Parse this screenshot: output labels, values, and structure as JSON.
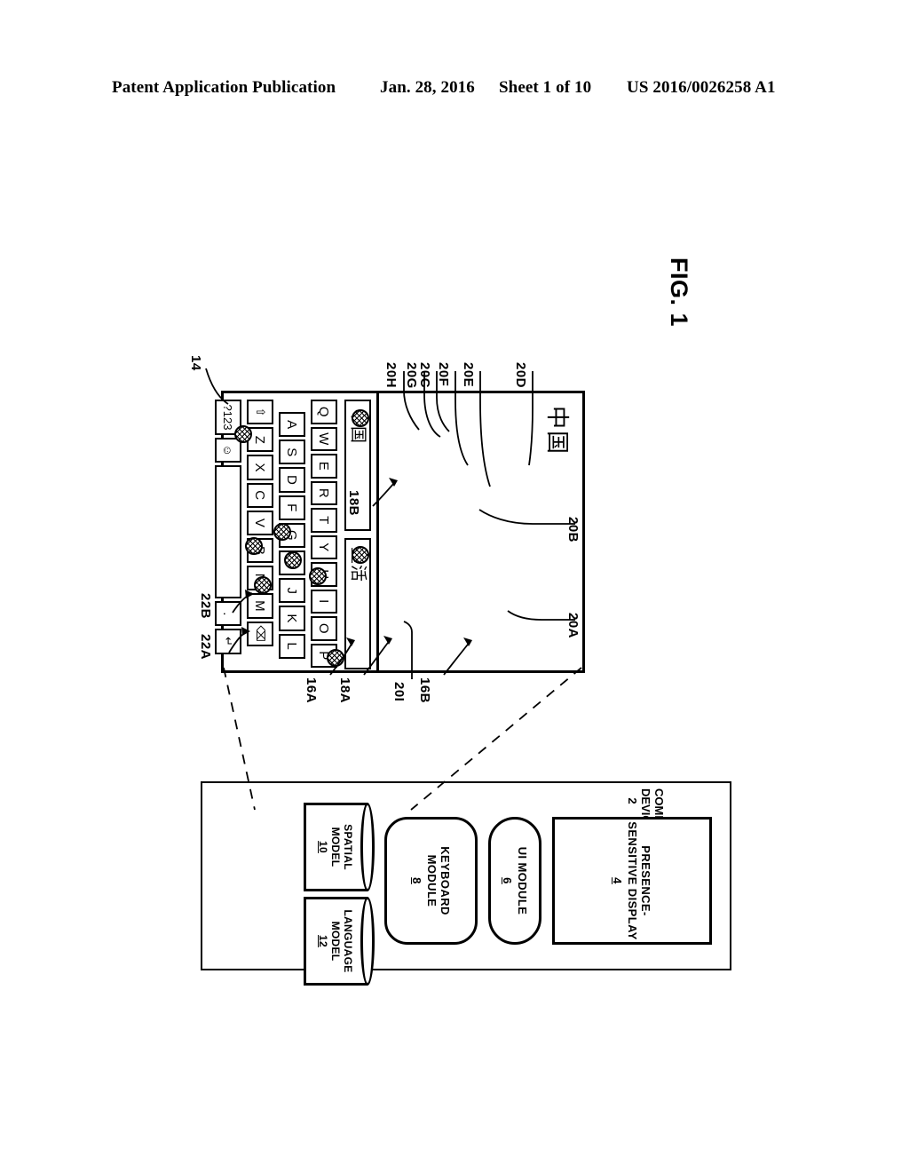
{
  "header": {
    "publication": "Patent Application Publication",
    "date": "Jan. 28, 2016",
    "sheet": "Sheet 1 of 10",
    "number": "US 2016/0026258 A1"
  },
  "figure": {
    "label": "FIG. 1"
  },
  "device": {
    "ref": "14",
    "text_area": {
      "ref_chars": [
        "22A",
        "22B"
      ],
      "committed_text": "中国"
    },
    "suggestion_bars": [
      {
        "ref": "18A",
        "text": "中国"
      },
      {
        "ref": "18B",
        "text": "重活"
      }
    ],
    "keyboard_refs": {
      "suggestion_region": "16A",
      "key_region": "16B"
    },
    "keys": {
      "row1": [
        "Q",
        "W",
        "E",
        "R",
        "T",
        "Y",
        "U",
        "I",
        "O",
        "P"
      ],
      "row2": [
        "A",
        "S",
        "D",
        "F",
        "G",
        "H",
        "J",
        "K",
        "L"
      ],
      "row3": [
        "⇧",
        "Z",
        "X",
        "C",
        "V",
        "B",
        "N",
        "M",
        "⌫"
      ],
      "row4": [
        "?123",
        "☺",
        " ",
        ".",
        "↵"
      ]
    },
    "touch_points": [
      {
        "ref": "20I",
        "on": "suggestion-bar-a"
      },
      {
        "ref": "20H",
        "on": "suggestion-bar-b"
      },
      {
        "ref": "20G",
        "on": "P"
      },
      {
        "ref": "20C",
        "on": "U"
      },
      {
        "ref": "20F",
        "on": "H"
      },
      {
        "ref": "20E",
        "on": "G"
      },
      {
        "ref": "20D",
        "on": "N"
      },
      {
        "ref": "20B",
        "on": "B"
      },
      {
        "ref": "20A",
        "on": "Z"
      }
    ]
  },
  "block_diagram": {
    "computing_device": {
      "label": "COMPUTING DEVICE",
      "num": "2"
    },
    "presence_sensitive_display": {
      "label1": "PRESENCE-",
      "label2": "SENSITIVE DISPLAY",
      "num": "4"
    },
    "ui_module": {
      "label": "UI MODULE",
      "num": "6"
    },
    "keyboard_module": {
      "label": "KEYBOARD MODULE",
      "num": "8"
    },
    "spatial_model": {
      "label1": "SPATIAL",
      "label2": "MODEL",
      "num": "10"
    },
    "language_model": {
      "label1": "LANGUAGE",
      "label2": "MODEL",
      "num": "12"
    }
  },
  "ref_labels": {
    "r14": "14",
    "r22A": "22A",
    "r22B": "22B",
    "r16A": "16A",
    "r16B": "16B",
    "r18A": "18A",
    "r18B": "18B",
    "r20A": "20A",
    "r20B": "20B",
    "r20C": "20C",
    "r20D": "20D",
    "r20E": "20E",
    "r20F": "20F",
    "r20G": "20G",
    "r20H": "20H",
    "r20I": "20I"
  },
  "colors": {
    "ink": "#000000",
    "paper": "#ffffff"
  }
}
